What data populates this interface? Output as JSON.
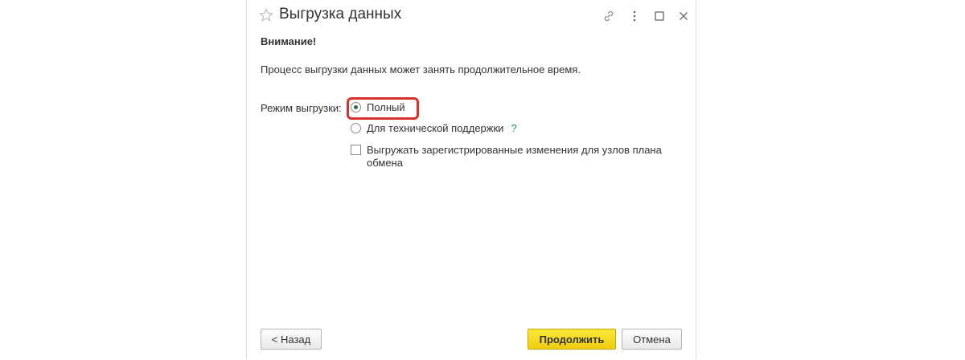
{
  "window": {
    "title": "Выгрузка данных"
  },
  "titlebar": {
    "icons": [
      "star-icon",
      "link-icon",
      "more-icon",
      "maximize-icon",
      "close-icon"
    ]
  },
  "content": {
    "warning_title": "Внимание!",
    "warning_text": "Процесс выгрузки данных может занять продолжительное время.",
    "mode_label": "Режим выгрузки:",
    "options": [
      {
        "label": "Полный",
        "type": "radio",
        "checked": true
      },
      {
        "label": "Для технической поддержки",
        "type": "radio",
        "checked": false,
        "help": "?"
      },
      {
        "label": "Выгружать зарегистрированные изменения для узлов плана обмена",
        "type": "checkbox",
        "checked": false
      }
    ]
  },
  "buttons": {
    "back": "< Назад",
    "continue": "Продолжить",
    "cancel": "Отмена"
  },
  "colors": {
    "accent_yellow": "#f5d81c",
    "highlight_red": "#d9302c",
    "help_teal": "#1a8c78",
    "radio_dot": "#2b6e3c"
  }
}
